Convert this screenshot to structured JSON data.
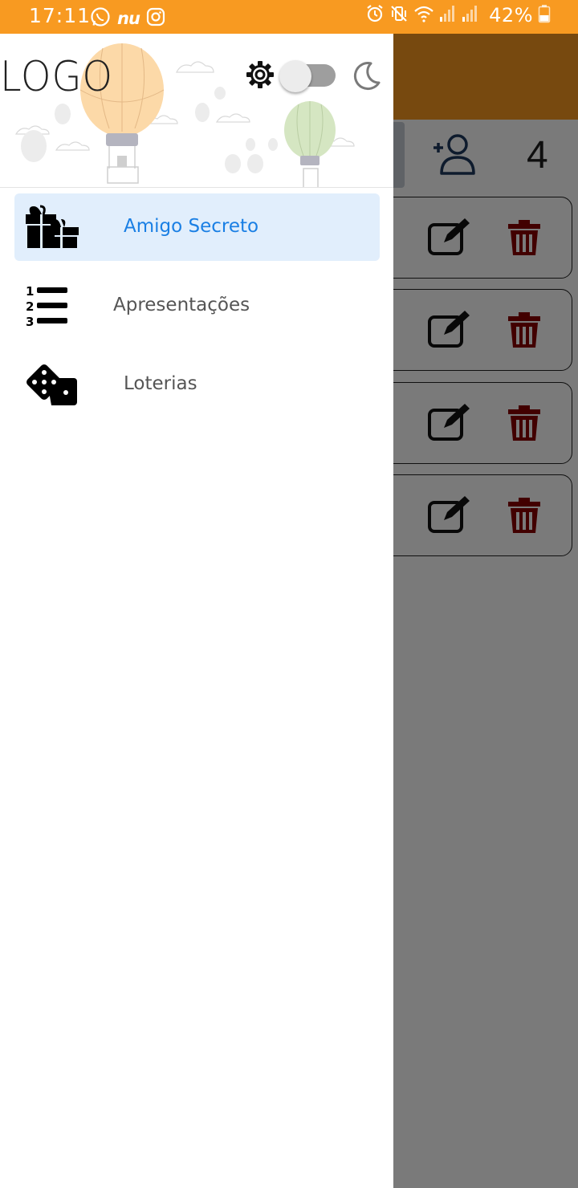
{
  "status_bar": {
    "time": "17:11",
    "nu_label": "nu",
    "battery_percent": "42%",
    "battery_level": 0.42,
    "left_icons": [
      "whatsapp-icon",
      "nubank-icon",
      "instagram-icon"
    ],
    "right_icons": [
      "alarm-icon",
      "mute-vibrate-icon",
      "wifi-icon",
      "signal-icon",
      "signal-icon",
      "battery-icon"
    ]
  },
  "background_app": {
    "count": "4",
    "list_rows": 4,
    "icons": [
      "add-user-icon",
      "edit-icon",
      "trash-icon"
    ]
  },
  "drawer": {
    "logo": "LOGO",
    "settings_icon": "gear-icon",
    "dark_mode_toggle": {
      "checked": false
    },
    "dark_mode_icon": "moon-icon",
    "menu": [
      {
        "label": "Amigo Secreto",
        "icon": "gift-icon",
        "active": true
      },
      {
        "label": "Apresentações",
        "icon": "numbered-list-icon",
        "active": false
      },
      {
        "label": "Loterias",
        "icon": "dice-icon",
        "active": false
      }
    ]
  },
  "colors": {
    "status_bar": "#f89a21",
    "active_item_bg": "#e1eefc",
    "active_item_text": "#1a7fe4",
    "inactive_item_text": "#555555",
    "delete_red": "#8b0000",
    "scrim": "rgba(0,0,0,0.52)"
  }
}
